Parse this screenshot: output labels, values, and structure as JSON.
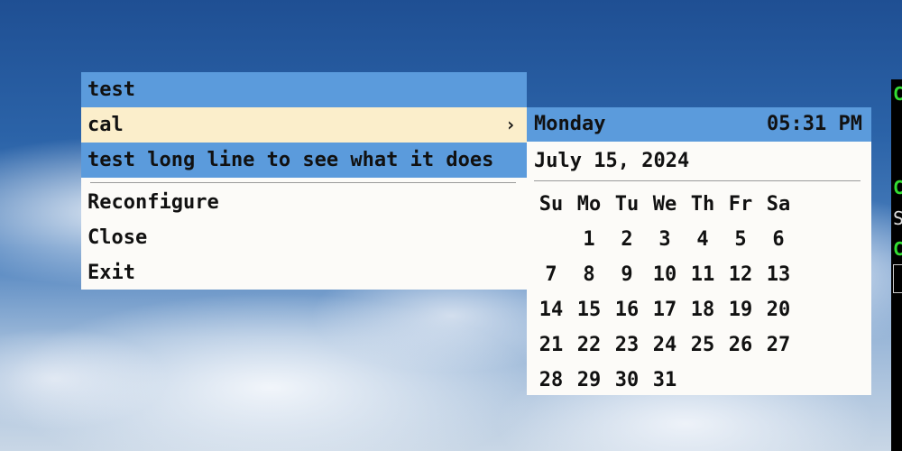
{
  "menu": {
    "items": [
      {
        "label": "test"
      },
      {
        "label": "cal",
        "arrow": "›"
      },
      {
        "label": "test long line to see what it does"
      },
      {
        "label": "Reconfigure"
      },
      {
        "label": "Close"
      },
      {
        "label": "Exit"
      }
    ]
  },
  "calendar": {
    "weekday": "Monday",
    "time": "05:31 PM",
    "date": "July 15, 2024",
    "day_headers": [
      "Su",
      "Mo",
      "Tu",
      "We",
      "Th",
      "Fr",
      "Sa"
    ],
    "days": [
      "",
      "1",
      "2",
      "3",
      "4",
      "5",
      "6",
      "7",
      "8",
      "9",
      "10",
      "11",
      "12",
      "13",
      "14",
      "15",
      "16",
      "17",
      "18",
      "19",
      "20",
      "21",
      "22",
      "23",
      "24",
      "25",
      "26",
      "27",
      "28",
      "29",
      "30",
      "31"
    ]
  },
  "terminal": {
    "lines": [
      "C",
      "C",
      "S",
      "C"
    ]
  },
  "colors": {
    "menu_bg": "#fcfbf8",
    "selection_blue": "#5b9bdc",
    "hover_cream": "#fbeecb",
    "terminal_green": "#33dd33"
  }
}
